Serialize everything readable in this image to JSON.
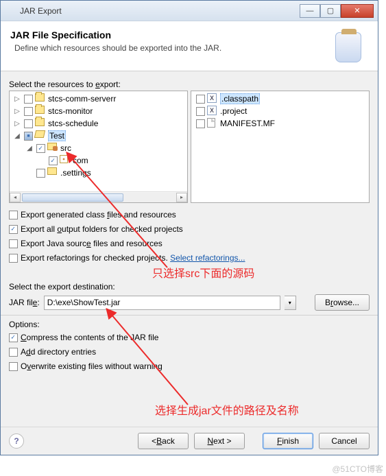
{
  "titlebar": {
    "title": "JAR Export"
  },
  "header": {
    "title": "JAR File Specification",
    "description": "Define which resources should be exported into the JAR."
  },
  "resources": {
    "label_html": "Select the resources to <u>e</u>xport:",
    "tree": [
      {
        "indent": 0,
        "expander": "▷",
        "check": "none",
        "icon": "proj",
        "label": "stcs-comm-serverr"
      },
      {
        "indent": 0,
        "expander": "▷",
        "check": "none",
        "icon": "proj",
        "label": "stcs-monitor"
      },
      {
        "indent": 0,
        "expander": "▷",
        "check": "none",
        "icon": "proj",
        "label": "stcs-schedule"
      },
      {
        "indent": 0,
        "expander": "◢",
        "check": "partial",
        "icon": "open",
        "label": "Test",
        "selected": true
      },
      {
        "indent": 1,
        "expander": "◢",
        "check": "checked",
        "icon": "src",
        "label": "src"
      },
      {
        "indent": 2,
        "expander": "",
        "check": "checked",
        "icon": "pkg",
        "label": "com"
      },
      {
        "indent": 1,
        "expander": "",
        "check": "none",
        "icon": "folder",
        "label": ".settings"
      }
    ],
    "files": [
      {
        "check": "none",
        "icon": "x",
        "label": ".classpath",
        "selected": true
      },
      {
        "check": "none",
        "icon": "x",
        "label": ".project"
      },
      {
        "check": "none",
        "icon": "file",
        "label": "MANIFEST.MF"
      }
    ]
  },
  "options1": {
    "generated": {
      "checked": false,
      "label_html": "Export generated class <u>f</u>iles and resources"
    },
    "outputfolders": {
      "checked": true,
      "label_html": "Export all <u>o</u>utput folders for checked projects"
    },
    "javasrc": {
      "checked": false,
      "label_html": "Export Java sourc<u>e</u> files and resources"
    },
    "refactor": {
      "checked": false,
      "label_html": "Export refactorin<u>g</u>s for checked projects."
    },
    "refactor_link": "Select refactorings..."
  },
  "destination": {
    "label": "Select the export destination:",
    "field_label_html": "JAR fil<u>e</u>:",
    "path": "D:\\exe\\ShowTest.jar",
    "browse_html": "B<u>r</u>owse..."
  },
  "options2": {
    "heading": "Options:",
    "compress": {
      "checked": true,
      "label_html": "<u>C</u>ompress the contents of the JAR file"
    },
    "adddir": {
      "checked": false,
      "label_html": "A<u>d</u>d directory entries"
    },
    "overwrite": {
      "checked": false,
      "label_html": "O<u>v</u>erwrite existing files without warning"
    }
  },
  "footer": {
    "back_html": "< <u>B</u>ack",
    "next_html": "<u>N</u>ext >",
    "finish_html": "<u>F</u>inish",
    "cancel": "Cancel"
  },
  "annotations": {
    "top": "只选择src下面的源码",
    "bottom": "选择生成jar文件的路径及名称"
  },
  "watermark": "@51CTO博客"
}
